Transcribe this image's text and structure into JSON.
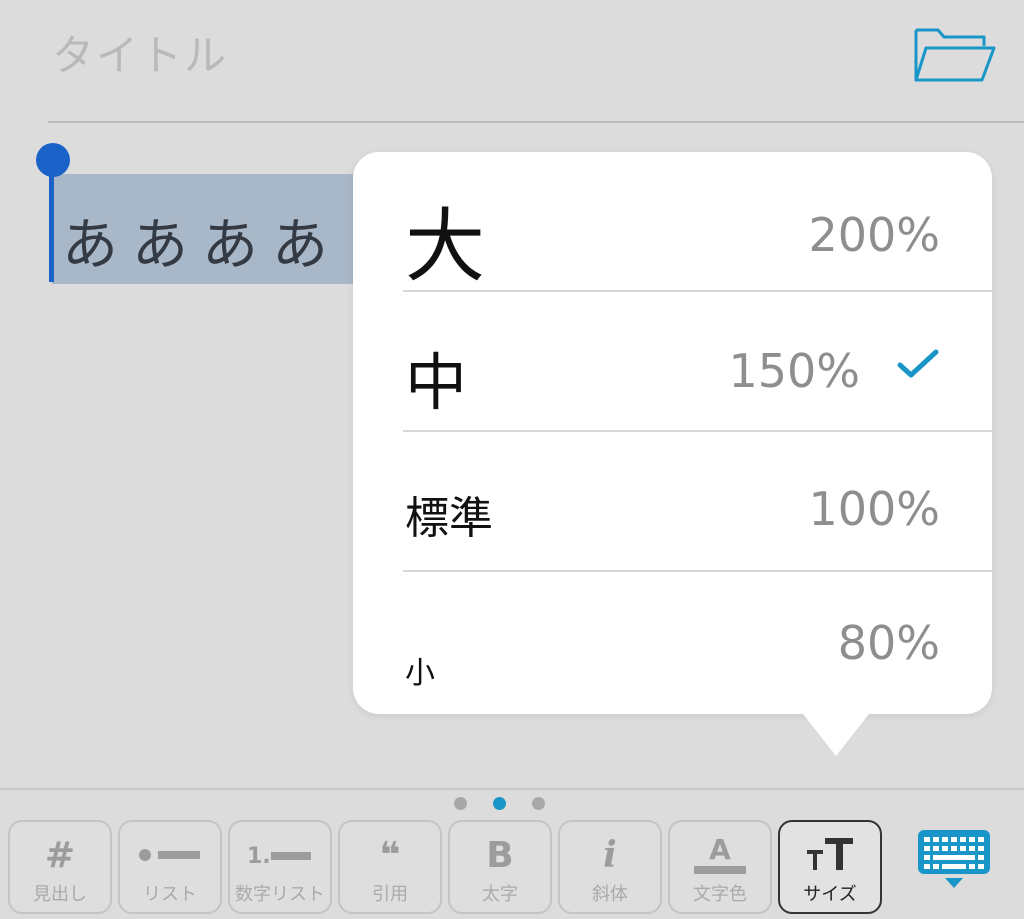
{
  "header": {
    "title_placeholder": "タイトル",
    "folder_icon": "folder-open-icon"
  },
  "editor": {
    "selected_text": "ああああ"
  },
  "size_popover": {
    "options": [
      {
        "label": "大",
        "percent": "200%",
        "selected": false
      },
      {
        "label": "中",
        "percent": "150%",
        "selected": true
      },
      {
        "label": "標準",
        "percent": "100%",
        "selected": false
      },
      {
        "label": "小",
        "percent": "80%",
        "selected": false
      }
    ],
    "check_color": "#1a95c8"
  },
  "toolbar": {
    "page_indicator": {
      "count": 3,
      "active": 2
    },
    "buttons": [
      {
        "glyph": "#",
        "label": "見出し",
        "icon": "heading-icon"
      },
      {
        "glyph": "",
        "label": "リスト",
        "icon": "bullet-list-icon"
      },
      {
        "glyph": "",
        "label": "数字リスト",
        "icon": "numbered-list-icon"
      },
      {
        "glyph": "❝",
        "label": "引用",
        "icon": "quote-icon"
      },
      {
        "glyph": "B",
        "label": "太字",
        "icon": "bold-icon"
      },
      {
        "glyph": "i",
        "label": "斜体",
        "icon": "italic-icon"
      },
      {
        "glyph": "A",
        "label": "文字色",
        "icon": "text-color-icon"
      },
      {
        "glyph": "",
        "label": "サイズ",
        "icon": "text-size-icon",
        "selected": true
      }
    ],
    "keyboard_icon": "keyboard-dismiss-icon",
    "accent_color": "#1a95c8"
  }
}
